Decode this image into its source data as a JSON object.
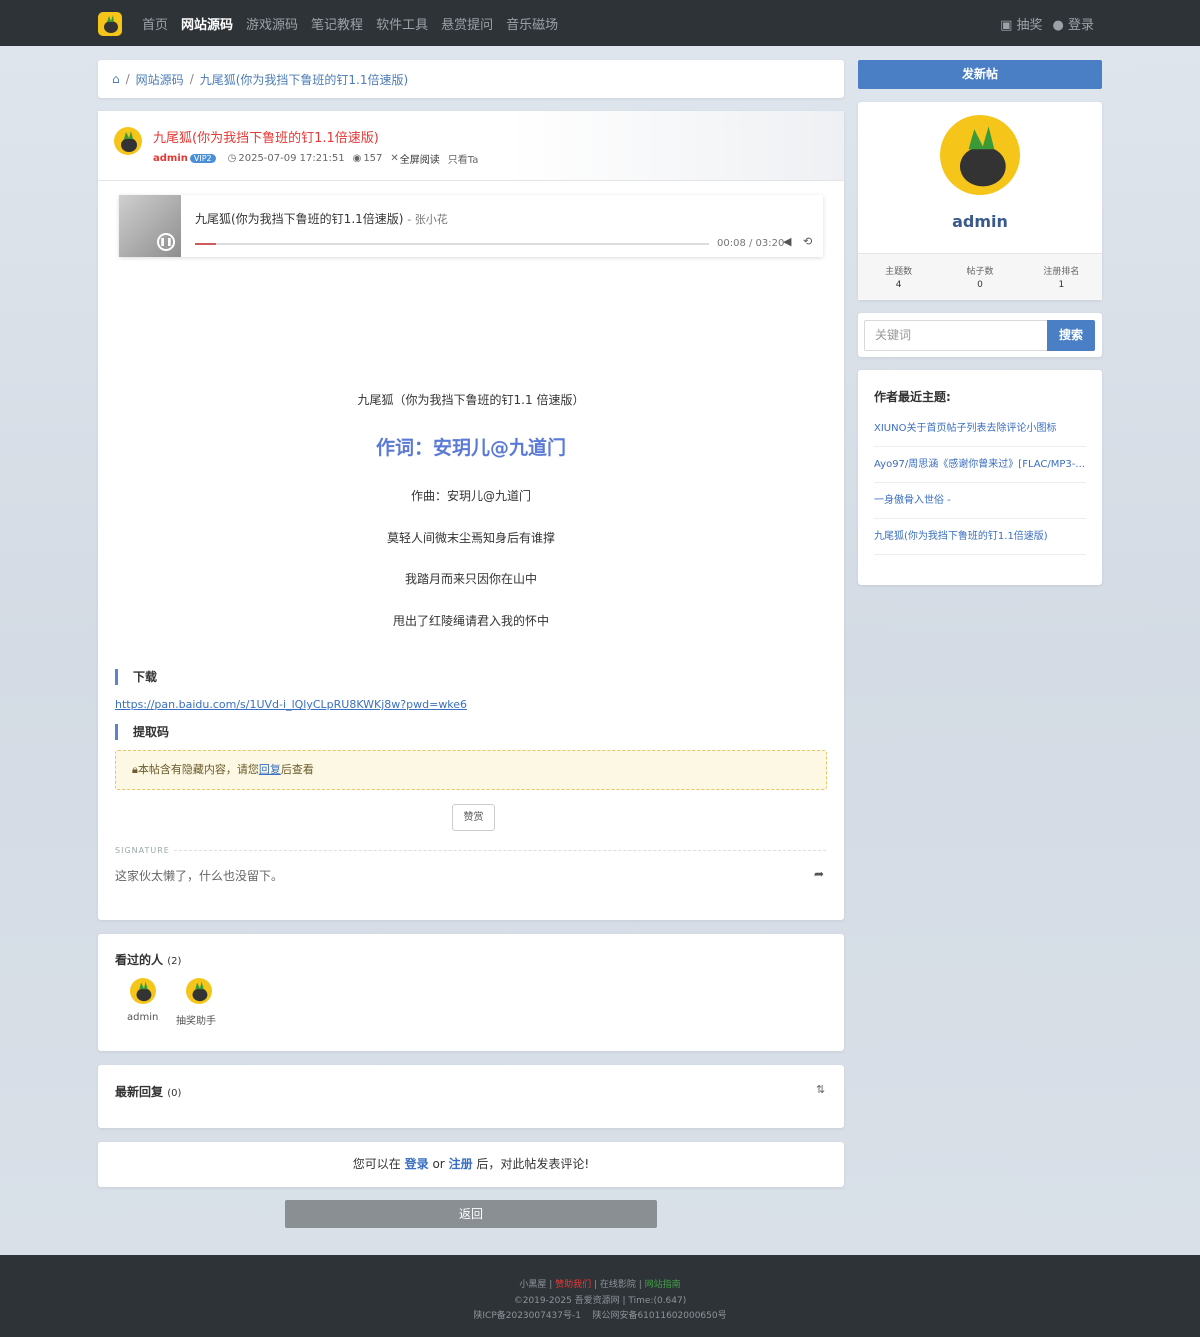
{
  "nav": {
    "items": [
      "首页",
      "网站源码",
      "游戏源码",
      "笔记教程",
      "软件工具",
      "悬赏提问",
      "音乐磁场"
    ],
    "active_index": 1,
    "lottery": "抽奖",
    "login": "登录"
  },
  "breadcrumb": {
    "section": "网站源码",
    "current": "九尾狐(你为我挡下鲁班的钉1.1倍速版)"
  },
  "post": {
    "title": "九尾狐(你为我挡下鲁班的钉1.1倍速版)",
    "author": "admin",
    "vip": "VIP2",
    "datetime": "2025-07-09 17:21:51",
    "views": "157",
    "fullscreen": "全屏阅读",
    "only_ta": "只看Ta"
  },
  "player": {
    "title": "九尾狐(你为我挡下鲁班的钉1.1倍速版)",
    "artist": "- 张小花",
    "time": "00:08 / 03:20",
    "progress": 0.04
  },
  "content": {
    "line1": "九尾狐（你为我挡下鲁班的钉1.1 倍速版）",
    "lyricist": "作词：安玥儿@九道门",
    "composer": "作曲：安玥儿@九道门",
    "l2": "莫轻人间微末尘焉知身后有谁撑",
    "l3": "我踏月而来只因你在山中",
    "l4": "甩出了红陵绳请君入我的怀中",
    "download_heading": "下载",
    "download_link": "https://pan.baidu.com/s/1UVd-i_lQlyCLpRU8KWKj8w?pwd=wke6",
    "code_heading": "提取码",
    "hidden_pre": "本帖含有隐藏内容，请您",
    "hidden_link": "回复",
    "hidden_post": "后查看",
    "reward": "赞赏"
  },
  "signature": {
    "label": "SIGNATURE",
    "text": "这家伙太懒了，什么也没留下。"
  },
  "viewers": {
    "title": "看过的人",
    "count": "(2)",
    "users": [
      "admin",
      "抽奖助手"
    ]
  },
  "replies": {
    "title": "最新回复",
    "count": "(0)"
  },
  "login_prompt": {
    "pre": "您可以在",
    "login": "登录",
    "or": "or",
    "register": "注册",
    "post": "后，对此帖发表评论!"
  },
  "back": "返回",
  "sidebar": {
    "new_post": "发新帖",
    "username": "admin",
    "stats": [
      {
        "label": "主题数",
        "value": "4"
      },
      {
        "label": "帖子数",
        "value": "0"
      },
      {
        "label": "注册排名",
        "value": "1"
      }
    ],
    "search_placeholder": "关键词",
    "search_btn": "搜索",
    "recent_title": "作者最近主题:",
    "recent": [
      "XIUNO关于首页帖子列表去除评论小图标",
      "Ayo97/周思涵《感谢你曾来过》[FLAC/MP3-...",
      "一身傲骨入世俗 -",
      "九尾狐(你为我挡下鲁班的钉1.1倍速版)"
    ]
  },
  "footer": {
    "a": "小黑屋",
    "b": "赞助我们",
    "c": "在线影院",
    "d": "网站指南",
    "copy": "©2019-2025 吾爱资源网 | Time:(0.647)",
    "icp": "陕ICP备2023007437号-1",
    "ga": "陕公网安备61011602000650号"
  },
  "colors": {
    "accent": "#4a7fc6",
    "title_red": "#e53935",
    "topbar": "#2e3338"
  }
}
